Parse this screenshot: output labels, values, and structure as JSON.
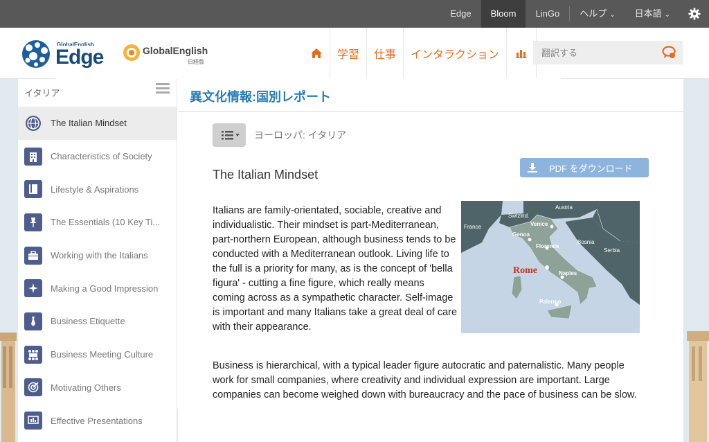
{
  "topbar": {
    "links": [
      {
        "label": "Edge",
        "active": false
      },
      {
        "label": "Bloom",
        "active": true
      },
      {
        "label": "LinGo",
        "active": false
      }
    ],
    "help_label": "ヘルプ",
    "language_label": "日本語"
  },
  "header": {
    "logo_sub": "GlobalEnglish",
    "logo_main": "Edge",
    "logo2_name": "GlobalEnglish",
    "logo2_sub": "日経版",
    "nav": {
      "learning": "学習",
      "work": "仕事",
      "interaction": "インタラクション"
    },
    "search_placeholder": "翻訳する"
  },
  "sidebar": {
    "title": "イタリア",
    "items": [
      {
        "label": "The Italian Mindset",
        "icon": "globe-icon",
        "active": true
      },
      {
        "label": "Characteristics of Society",
        "icon": "building-icon",
        "active": false
      },
      {
        "label": "Lifestyle & Aspirations",
        "icon": "book-icon",
        "active": false
      },
      {
        "label": "The Essentials (10 Key Ti...",
        "icon": "pin-icon",
        "active": false
      },
      {
        "label": "Working with the Italians",
        "icon": "briefcase-icon",
        "active": false
      },
      {
        "label": "Making a Good Impression",
        "icon": "sparkle-icon",
        "active": false
      },
      {
        "label": "Business Etiquette",
        "icon": "tie-icon",
        "active": false
      },
      {
        "label": "Business Meeting Culture",
        "icon": "meeting-icon",
        "active": false
      },
      {
        "label": "Motivating Others",
        "icon": "target-icon",
        "active": false
      },
      {
        "label": "Effective Presentations",
        "icon": "presentation-icon",
        "active": false
      }
    ]
  },
  "main": {
    "title": "異文化情報:国別レポート",
    "breadcrumb": "ヨーロッパ: イタリア",
    "pdf_label": "PDF をダウンロード",
    "heading": "The Italian Mindset",
    "paragraph1": "Italians are family-orientated, sociable, creative and individualistic. Their mindset is part-Mediterranean, part-northern European, although business tends to be conducted with a Mediterranean outlook. Living life to the full is a priority for many, as is the concept of 'bella figura' - cutting a fine figure, which really means coming across as a sympathetic character. Self-image is important and many Italians take a great deal of care with their appearance.",
    "paragraph2": "Business is hierarchical, with a typical leader figure autocratic and paternalistic. Many people work for small companies, where creativity and individual expression are important. Large companies can become weighed down with bureaucracy and the pace of business can be slow."
  },
  "map": {
    "labels": {
      "austria": "Austria",
      "switzerland": "Swtzlnd.",
      "france": "France",
      "venice": "Venice",
      "genoa": "Genoa",
      "florence": "Florence",
      "bosnia": "Bosnia",
      "serbia": "Serbia",
      "rome": "Rome",
      "naples": "Naples",
      "palermo": "Palermo"
    }
  },
  "colors": {
    "accent_orange": "#e86a1c",
    "title_blue": "#2a7bb8",
    "pdf_button": "#8cb4dd",
    "sidebar_icon": "#4e5d8c"
  }
}
